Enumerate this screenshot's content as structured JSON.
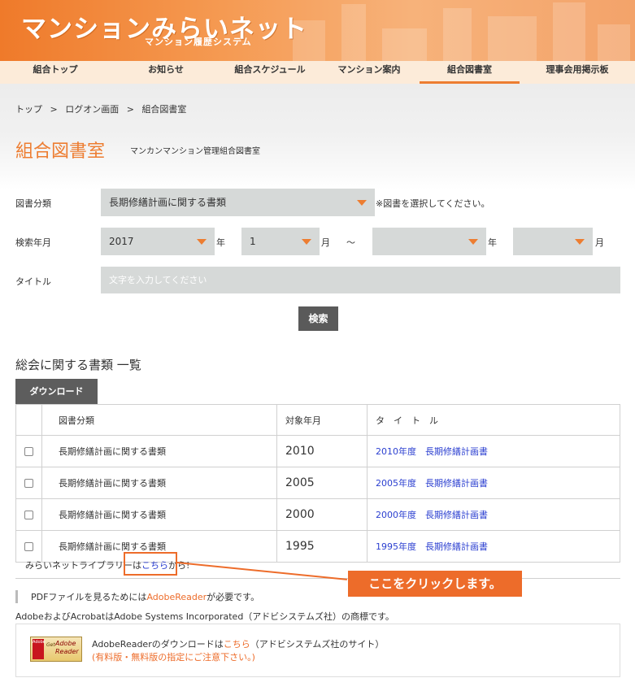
{
  "header": {
    "logo": "マンションみらいネット",
    "logo_sub": "マンション履歴システム"
  },
  "nav": {
    "items": [
      {
        "label": "組合トップ"
      },
      {
        "label": "お知らせ"
      },
      {
        "label": "組合スケジュール"
      },
      {
        "label": "マンション案内"
      },
      {
        "label": "組合図書室",
        "active": true
      },
      {
        "label": "理事会用掲示板"
      }
    ]
  },
  "breadcrumb": [
    "トップ",
    ">",
    "ログオン画面",
    ">",
    "組合図書室"
  ],
  "page": {
    "title": "組合図書室",
    "subtitle": "マンカンマンション管理組合図書室"
  },
  "form": {
    "category_label": "図書分類",
    "category_value": "長期修繕計画に関する書類",
    "category_note": "※図書を選択してください。",
    "date_label": "検索年月",
    "from_year": "2017",
    "from_month": "1",
    "to_year": "",
    "to_month": "",
    "year_unit": "年",
    "month_unit": "月",
    "tilde": "〜",
    "title_label": "タイトル",
    "title_placeholder": "文字を入力してください",
    "search_label": "検索"
  },
  "list": {
    "section_title": "総会に関する書類 一覧",
    "download_label": "ダウンロード",
    "columns": [
      "",
      "図書分類",
      "対象年月",
      "タ　イ　ト　ル"
    ],
    "rows": [
      {
        "category": "長期修繕計画に関する書類",
        "year": "2010",
        "title": "2010年度　長期修繕計画書"
      },
      {
        "category": "長期修繕計画に関する書類",
        "year": "2005",
        "title": "2005年度　長期修繕計画書"
      },
      {
        "category": "長期修繕計画に関する書類",
        "year": "2000",
        "title": "2000年度　長期修繕計画書"
      },
      {
        "category": "長期修繕計画に関する書類",
        "year": "1995",
        "title": "1995年度　長期修繕計画書"
      }
    ]
  },
  "library": {
    "prefix": "みらいネットライブラリーは",
    "link": "こちら",
    "suffix": "から!"
  },
  "callout": {
    "text": "ここをクリックします。"
  },
  "pdf": {
    "note_prefix": "PDFファイルを見るためには",
    "note_link": "AdobeReader",
    "note_suffix": "が必要です。",
    "trademark": "AdobeおよびAcrobatはAdobe Systems Incorporated（アドビシステムズ社）の商標です。",
    "dl_prefix": "AdobeReaderのダウンロードは",
    "dl_link": "こちら",
    "dl_suffix": "（アドビシステムズ社のサイト）",
    "dl_warning": "(有料版・無料版の指定にご注意下さい。)",
    "logo_get": "Get",
    "logo_adobe": "Adobe",
    "logo_reader": "Reader",
    "logo_mark": "Adobe"
  },
  "colors": {
    "accent": "#ed7d31",
    "link": "#2b3fd0",
    "field_bg": "#d6d9d8"
  }
}
